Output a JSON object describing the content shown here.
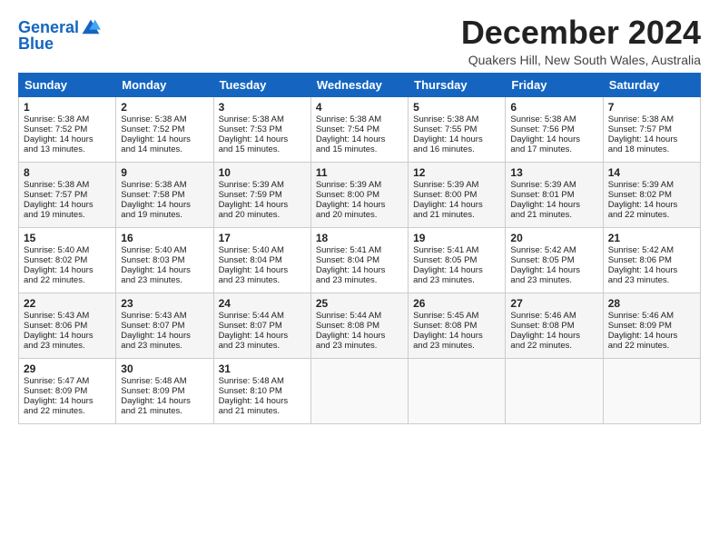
{
  "logo": {
    "line1": "General",
    "line2": "Blue"
  },
  "title": "December 2024",
  "location": "Quakers Hill, New South Wales, Australia",
  "days_header": [
    "Sunday",
    "Monday",
    "Tuesday",
    "Wednesday",
    "Thursday",
    "Friday",
    "Saturday"
  ],
  "weeks": [
    [
      {
        "num": "1",
        "lines": [
          "Sunrise: 5:38 AM",
          "Sunset: 7:52 PM",
          "Daylight: 14 hours",
          "and 13 minutes."
        ]
      },
      {
        "num": "2",
        "lines": [
          "Sunrise: 5:38 AM",
          "Sunset: 7:52 PM",
          "Daylight: 14 hours",
          "and 14 minutes."
        ]
      },
      {
        "num": "3",
        "lines": [
          "Sunrise: 5:38 AM",
          "Sunset: 7:53 PM",
          "Daylight: 14 hours",
          "and 15 minutes."
        ]
      },
      {
        "num": "4",
        "lines": [
          "Sunrise: 5:38 AM",
          "Sunset: 7:54 PM",
          "Daylight: 14 hours",
          "and 15 minutes."
        ]
      },
      {
        "num": "5",
        "lines": [
          "Sunrise: 5:38 AM",
          "Sunset: 7:55 PM",
          "Daylight: 14 hours",
          "and 16 minutes."
        ]
      },
      {
        "num": "6",
        "lines": [
          "Sunrise: 5:38 AM",
          "Sunset: 7:56 PM",
          "Daylight: 14 hours",
          "and 17 minutes."
        ]
      },
      {
        "num": "7",
        "lines": [
          "Sunrise: 5:38 AM",
          "Sunset: 7:57 PM",
          "Daylight: 14 hours",
          "and 18 minutes."
        ]
      }
    ],
    [
      {
        "num": "8",
        "lines": [
          "Sunrise: 5:38 AM",
          "Sunset: 7:57 PM",
          "Daylight: 14 hours",
          "and 19 minutes."
        ]
      },
      {
        "num": "9",
        "lines": [
          "Sunrise: 5:38 AM",
          "Sunset: 7:58 PM",
          "Daylight: 14 hours",
          "and 19 minutes."
        ]
      },
      {
        "num": "10",
        "lines": [
          "Sunrise: 5:39 AM",
          "Sunset: 7:59 PM",
          "Daylight: 14 hours",
          "and 20 minutes."
        ]
      },
      {
        "num": "11",
        "lines": [
          "Sunrise: 5:39 AM",
          "Sunset: 8:00 PM",
          "Daylight: 14 hours",
          "and 20 minutes."
        ]
      },
      {
        "num": "12",
        "lines": [
          "Sunrise: 5:39 AM",
          "Sunset: 8:00 PM",
          "Daylight: 14 hours",
          "and 21 minutes."
        ]
      },
      {
        "num": "13",
        "lines": [
          "Sunrise: 5:39 AM",
          "Sunset: 8:01 PM",
          "Daylight: 14 hours",
          "and 21 minutes."
        ]
      },
      {
        "num": "14",
        "lines": [
          "Sunrise: 5:39 AM",
          "Sunset: 8:02 PM",
          "Daylight: 14 hours",
          "and 22 minutes."
        ]
      }
    ],
    [
      {
        "num": "15",
        "lines": [
          "Sunrise: 5:40 AM",
          "Sunset: 8:02 PM",
          "Daylight: 14 hours",
          "and 22 minutes."
        ]
      },
      {
        "num": "16",
        "lines": [
          "Sunrise: 5:40 AM",
          "Sunset: 8:03 PM",
          "Daylight: 14 hours",
          "and 23 minutes."
        ]
      },
      {
        "num": "17",
        "lines": [
          "Sunrise: 5:40 AM",
          "Sunset: 8:04 PM",
          "Daylight: 14 hours",
          "and 23 minutes."
        ]
      },
      {
        "num": "18",
        "lines": [
          "Sunrise: 5:41 AM",
          "Sunset: 8:04 PM",
          "Daylight: 14 hours",
          "and 23 minutes."
        ]
      },
      {
        "num": "19",
        "lines": [
          "Sunrise: 5:41 AM",
          "Sunset: 8:05 PM",
          "Daylight: 14 hours",
          "and 23 minutes."
        ]
      },
      {
        "num": "20",
        "lines": [
          "Sunrise: 5:42 AM",
          "Sunset: 8:05 PM",
          "Daylight: 14 hours",
          "and 23 minutes."
        ]
      },
      {
        "num": "21",
        "lines": [
          "Sunrise: 5:42 AM",
          "Sunset: 8:06 PM",
          "Daylight: 14 hours",
          "and 23 minutes."
        ]
      }
    ],
    [
      {
        "num": "22",
        "lines": [
          "Sunrise: 5:43 AM",
          "Sunset: 8:06 PM",
          "Daylight: 14 hours",
          "and 23 minutes."
        ]
      },
      {
        "num": "23",
        "lines": [
          "Sunrise: 5:43 AM",
          "Sunset: 8:07 PM",
          "Daylight: 14 hours",
          "and 23 minutes."
        ]
      },
      {
        "num": "24",
        "lines": [
          "Sunrise: 5:44 AM",
          "Sunset: 8:07 PM",
          "Daylight: 14 hours",
          "and 23 minutes."
        ]
      },
      {
        "num": "25",
        "lines": [
          "Sunrise: 5:44 AM",
          "Sunset: 8:08 PM",
          "Daylight: 14 hours",
          "and 23 minutes."
        ]
      },
      {
        "num": "26",
        "lines": [
          "Sunrise: 5:45 AM",
          "Sunset: 8:08 PM",
          "Daylight: 14 hours",
          "and 23 minutes."
        ]
      },
      {
        "num": "27",
        "lines": [
          "Sunrise: 5:46 AM",
          "Sunset: 8:08 PM",
          "Daylight: 14 hours",
          "and 22 minutes."
        ]
      },
      {
        "num": "28",
        "lines": [
          "Sunrise: 5:46 AM",
          "Sunset: 8:09 PM",
          "Daylight: 14 hours",
          "and 22 minutes."
        ]
      }
    ],
    [
      {
        "num": "29",
        "lines": [
          "Sunrise: 5:47 AM",
          "Sunset: 8:09 PM",
          "Daylight: 14 hours",
          "and 22 minutes."
        ]
      },
      {
        "num": "30",
        "lines": [
          "Sunrise: 5:48 AM",
          "Sunset: 8:09 PM",
          "Daylight: 14 hours",
          "and 21 minutes."
        ]
      },
      {
        "num": "31",
        "lines": [
          "Sunrise: 5:48 AM",
          "Sunset: 8:10 PM",
          "Daylight: 14 hours",
          "and 21 minutes."
        ]
      },
      null,
      null,
      null,
      null
    ]
  ]
}
